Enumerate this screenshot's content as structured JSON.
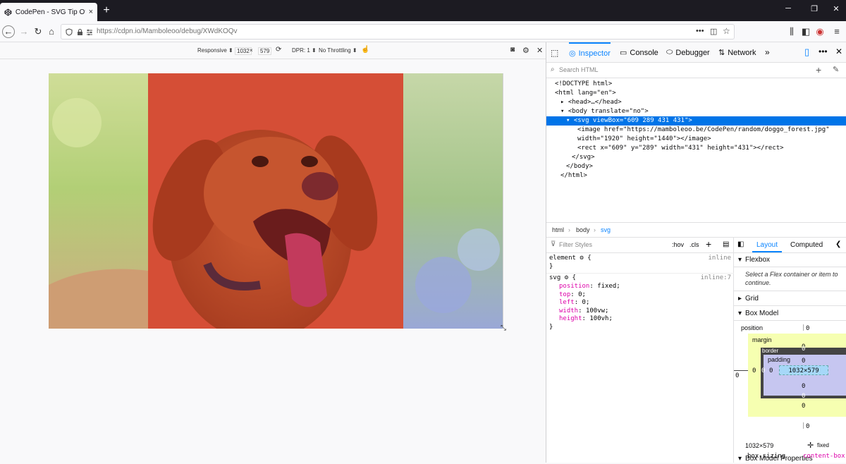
{
  "tab": {
    "title": "CodePen - SVG Tip Of The Day",
    "close": "×"
  },
  "new_tab": "+",
  "url": "https://cdpn.io/Mamboleoo/debug/XWdKOQv",
  "rdm": {
    "device": "Responsive ⬍",
    "width": "1032",
    "times": "×",
    "height": "579",
    "dpr": "DPR: 1 ⬍",
    "throttling": "No Throttling ⬍"
  },
  "devtools": {
    "tabs": [
      "Inspector",
      "Console",
      "Debugger",
      "Network"
    ],
    "search_placeholder": "Search HTML",
    "tree": [
      {
        "indent": 1,
        "text": "<!DOCTYPE html>"
      },
      {
        "indent": 1,
        "text": "<html lang=\"en\">"
      },
      {
        "indent": 2,
        "text": "▸ <head>…</head>"
      },
      {
        "indent": 2,
        "text": "▾ <body translate=\"no\">"
      },
      {
        "indent": 3,
        "text": "▾ <svg viewBox=\"609 289 431 431\">",
        "selected": true
      },
      {
        "indent": 5,
        "text": "<image href=\"https://mamboleoo.be/CodePen/random/doggo_forest.jpg\""
      },
      {
        "indent": 5,
        "text": "width=\"1920\" height=\"1440\"></image>"
      },
      {
        "indent": 5,
        "text": "<rect x=\"609\" y=\"289\" width=\"431\" height=\"431\"></rect>"
      },
      {
        "indent": 4,
        "text": "</svg>"
      },
      {
        "indent": 3,
        "text": "</body>"
      },
      {
        "indent": 2,
        "text": "</html>"
      }
    ],
    "breadcrumbs": [
      "html",
      "body",
      "svg"
    ],
    "filter_placeholder": "Filter Styles",
    "hov": ":hov",
    "cls": ".cls",
    "rules": {
      "element_label": "element",
      "element_source": "inline",
      "svg_selector": "svg",
      "svg_source": "inline:7",
      "declarations": [
        {
          "prop": "position",
          "val": "fixed;"
        },
        {
          "prop": "top",
          "val": "0;"
        },
        {
          "prop": "left",
          "val": "0;"
        },
        {
          "prop": "width",
          "val": "100vw;"
        },
        {
          "prop": "height",
          "val": "100vh;"
        }
      ]
    },
    "layout": {
      "tabs": [
        "Layout",
        "Computed"
      ],
      "flexbox_title": "Flexbox",
      "flexbox_msg": "Select a Flex container or item to continue.",
      "grid_title": "Grid",
      "boxmodel_title": "Box Model",
      "position_label": "position",
      "position_val": "0",
      "margin_label": "margin",
      "border_label": "border",
      "padding_label": "padding",
      "content_size": "1032×579",
      "zero": "0",
      "size_footer": "1032×579",
      "position_footer": "fixed",
      "props_title": "Box Model Properties",
      "box_sizing_prop": "box-sizing",
      "box_sizing_val": "content-box"
    }
  },
  "colors": {
    "accent": "#0a84ff",
    "selection": "#0074e8",
    "overlay": "#e0462f"
  }
}
